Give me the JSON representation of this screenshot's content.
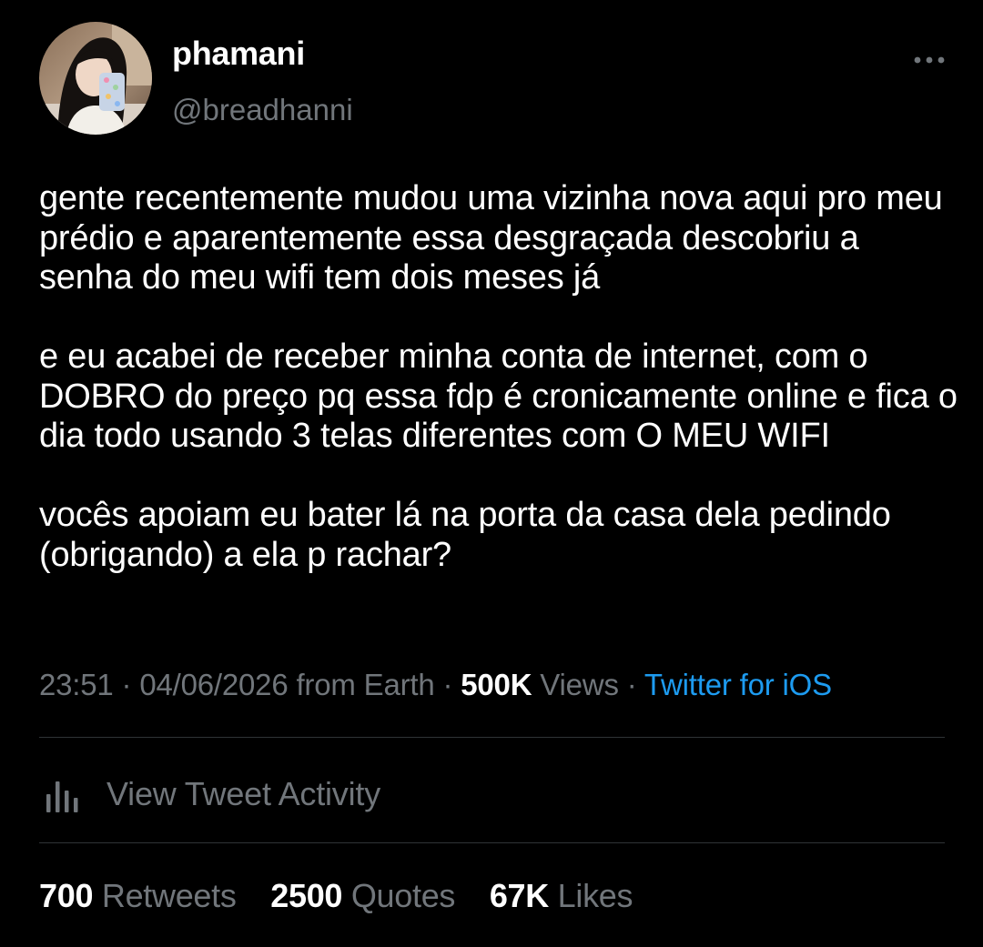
{
  "author": {
    "display_name": "phamani",
    "handle": "@breadhanni",
    "avatar_icon": "profile-photo"
  },
  "more_icon": "more-horizontal-icon",
  "tweet": {
    "paragraphs": [
      "gente recentemente mudou uma vizinha nova aqui pro meu prédio e aparentemente essa desgraçada descobriu a senha do meu wifi tem dois meses já",
      "e eu acabei de receber minha conta de internet, com o DOBRO do preço pq essa fdp é cronicamente online e fica o dia todo usando 3 telas diferentes com O MEU WIFI",
      "vocês apoiam eu bater lá na porta da casa dela pedindo (obrigando) a ela p rachar?"
    ]
  },
  "meta": {
    "time": "23:51",
    "separator": " · ",
    "date": "04/06/2026",
    "from_label": " from Earth",
    "views_count": "500K",
    "views_label": " Views",
    "source": "Twitter for iOS"
  },
  "activity": {
    "icon": "bar-chart-icon",
    "label": "View Tweet Activity"
  },
  "stats": {
    "retweets_count": "700",
    "retweets_label": " Retweets",
    "quotes_count": "2500",
    "quotes_label": " Quotes",
    "likes_count": "67K",
    "likes_label": " Likes"
  },
  "colors": {
    "background": "#000000",
    "text_primary": "#ffffff",
    "text_secondary": "#71767b",
    "link": "#1d9bf0",
    "divider": "#2f3336"
  }
}
